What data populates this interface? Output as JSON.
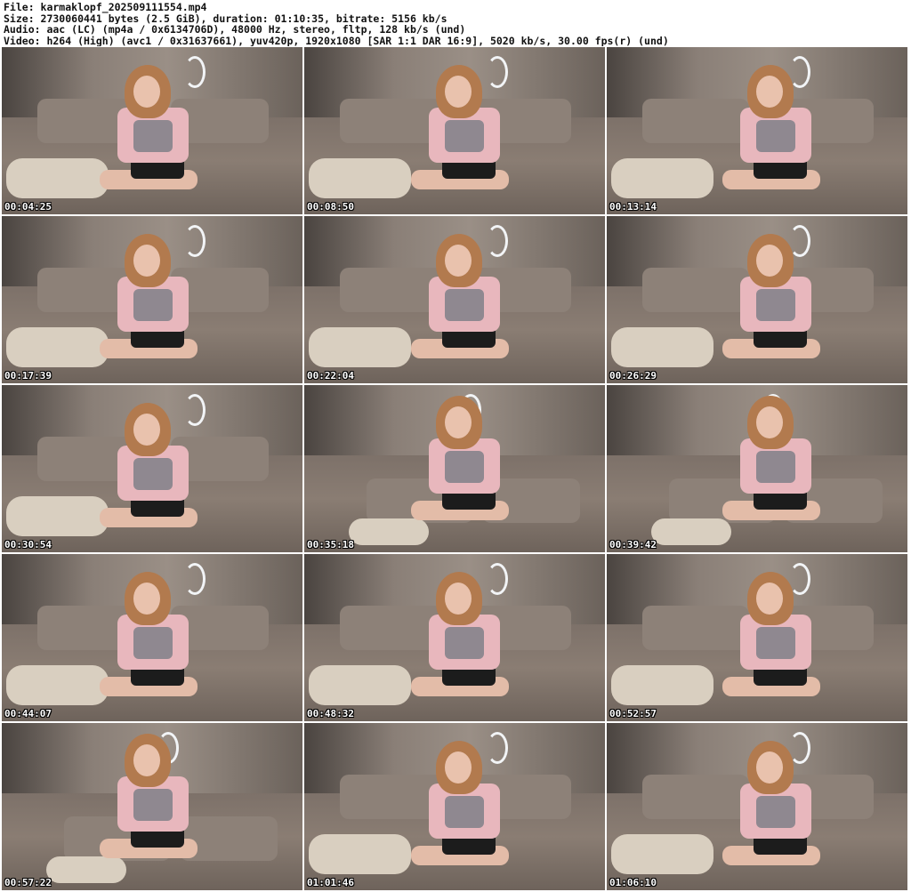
{
  "header": {
    "file": "File: karmaklopf_202509111554.mp4",
    "size": "Size: 2730060441 bytes (2.5 GiB), duration: 01:10:35, bitrate: 5156 kb/s",
    "audio": "Audio: aac (LC) (mp4a / 0x6134706D), 48000 Hz, stereo, fltp, 128 kb/s (und)",
    "video": "Video: h264 (High) (avc1 / 0x31637661), yuv420p, 1920x1080 [SAR 1:1 DAR 16:9], 5020 kb/s, 30.00 fps(r) (und)"
  },
  "thumbnails": [
    {
      "timestamp": "00:04:25"
    },
    {
      "timestamp": "00:08:50"
    },
    {
      "timestamp": "00:13:14"
    },
    {
      "timestamp": "00:17:39"
    },
    {
      "timestamp": "00:22:04"
    },
    {
      "timestamp": "00:26:29"
    },
    {
      "timestamp": "00:30:54"
    },
    {
      "timestamp": "00:35:18"
    },
    {
      "timestamp": "00:39:42"
    },
    {
      "timestamp": "00:44:07"
    },
    {
      "timestamp": "00:48:32"
    },
    {
      "timestamp": "00:52:57"
    },
    {
      "timestamp": "00:57:22"
    },
    {
      "timestamp": "01:01:46"
    },
    {
      "timestamp": "01:06:10"
    }
  ]
}
